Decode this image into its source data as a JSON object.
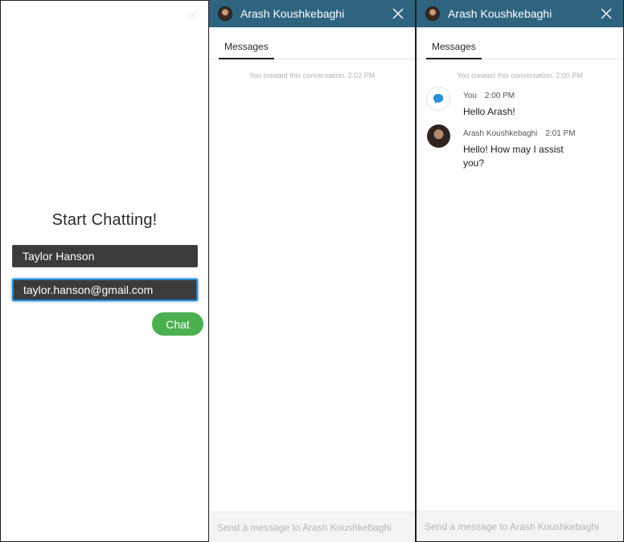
{
  "start_panel": {
    "title": "Start Chatting!",
    "name_value": "Taylor Hanson",
    "email_value": "taylor.hanson@gmail.com",
    "chat_button": "Chat",
    "close_icon": "close-icon"
  },
  "chat_panel_1": {
    "header_name": "Arash Koushkebaghi",
    "tab_label": "Messages",
    "system_message": "You created this conversation. 2:02 PM",
    "composer_placeholder": "Send a message to Arash Koushkebaghi"
  },
  "chat_panel_2": {
    "header_name": "Arash Koushkebaghi",
    "tab_label": "Messages",
    "system_message": "You created this conversation. 2:00 PM",
    "composer_placeholder": "Send a message to Arash Koushkebaghi",
    "messages": [
      {
        "sender": "You",
        "time": "2:00 PM",
        "text": "Hello Arash!"
      },
      {
        "sender": "Arash Koushkebaghi",
        "time": "2:01 PM",
        "text": "Hello! How may I assist you?"
      }
    ]
  },
  "colors": {
    "header": "#2e6480",
    "chat_button": "#4caf50",
    "input_bg": "#3b3b3b",
    "focus_ring": "#1f8ad6",
    "you_bubble_icon": "#2a8fd4"
  }
}
